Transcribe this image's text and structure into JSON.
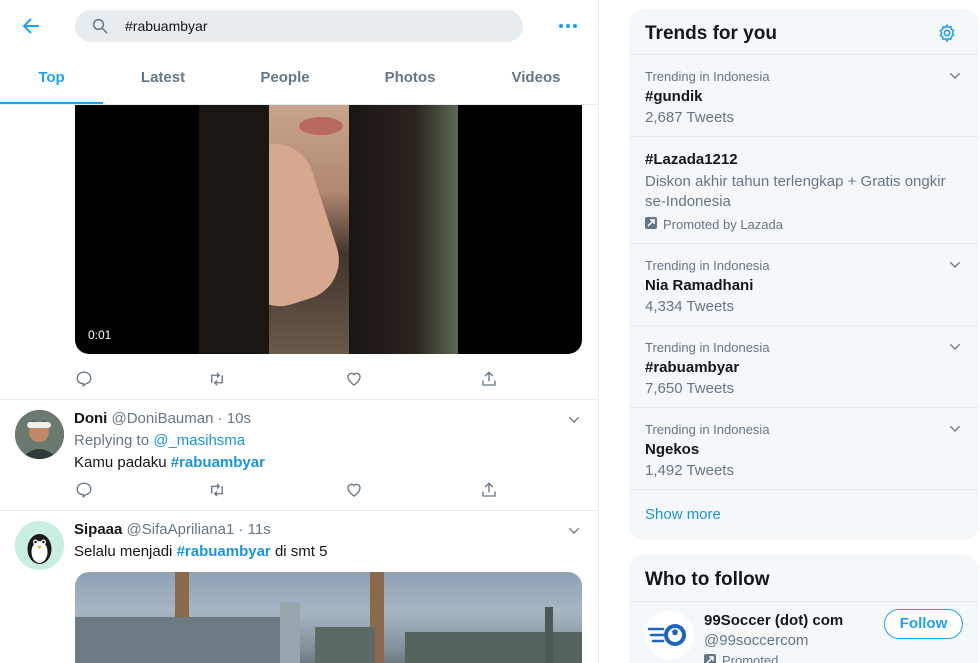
{
  "search": {
    "query": "#rabuambyar"
  },
  "tabs": [
    {
      "label": "Top"
    },
    {
      "label": "Latest"
    },
    {
      "label": "People"
    },
    {
      "label": "Photos"
    },
    {
      "label": "Videos"
    }
  ],
  "video": {
    "duration": "0:01"
  },
  "tweets": [
    {
      "name": "Doni",
      "handle": "@DoniBauman · 10s",
      "replying_prefix": "Replying to ",
      "replying_to": "@_masihsma",
      "text": "Kamu padaku ",
      "hashtag": "#rabuambyar",
      "text_after": ""
    },
    {
      "name": "Sipaaa",
      "handle": "@SifaApriliana1 · 11s",
      "text": "Selalu menjadi ",
      "hashtag": "#rabuambyar",
      "text_after": " di smt 5"
    }
  ],
  "trends": {
    "title": "Trends for you",
    "items": [
      {
        "context": "Trending in Indonesia",
        "topic": "#gundik",
        "count": "2,687 Tweets"
      },
      {
        "topic": "#Lazada1212",
        "description": "Diskon akhir tahun terlengkap + Gratis ongkir se-Indonesia",
        "promoted": "Promoted by Lazada"
      },
      {
        "context": "Trending in Indonesia",
        "topic": "Nia Ramadhani",
        "count": "4,334 Tweets"
      },
      {
        "context": "Trending in Indonesia",
        "topic": "#rabuambyar",
        "count": "7,650 Tweets"
      },
      {
        "context": "Trending in Indonesia",
        "topic": "Ngekos",
        "count": "1,492 Tweets"
      }
    ],
    "show_more": "Show more"
  },
  "who_to_follow": {
    "title": "Who to follow",
    "account": {
      "name": "99Soccer (dot) com",
      "handle": "@99soccercom",
      "promoted": "Promoted",
      "button": "Follow"
    }
  },
  "colors": {
    "accent": "#1da1f2",
    "link": "#1b95e0",
    "muted": "#657786"
  }
}
